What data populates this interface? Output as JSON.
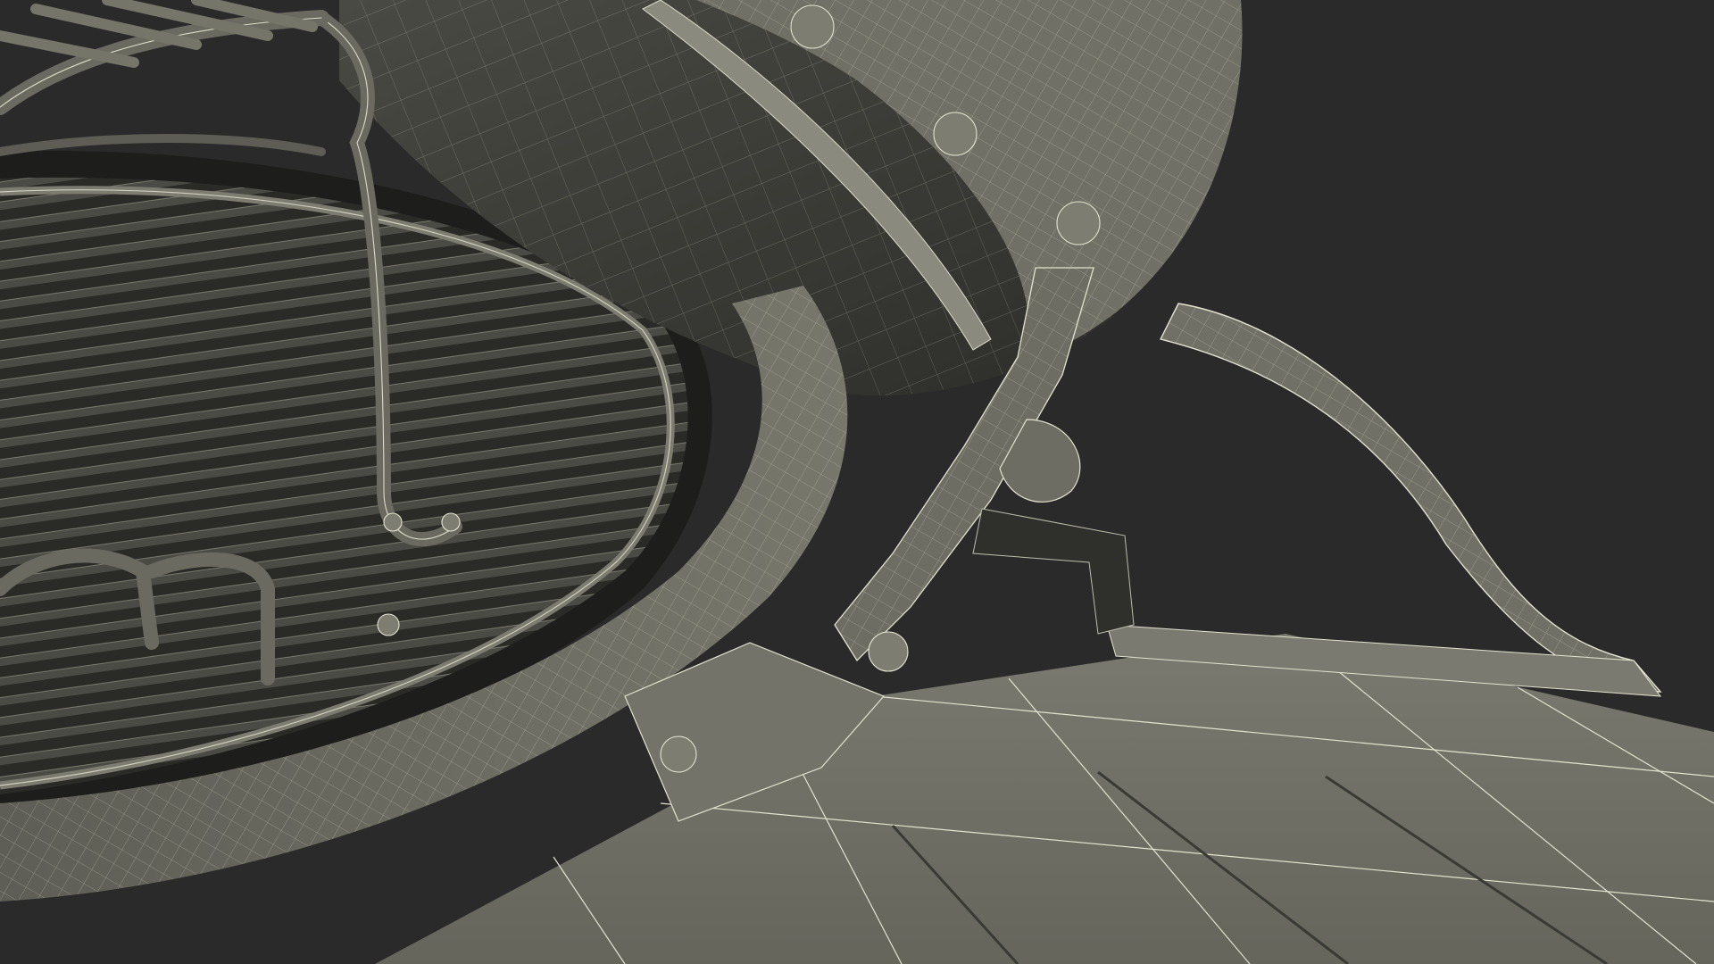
{
  "scene": {
    "subject": "grill-wireframe-render",
    "render_mode": "wireframe-over-shaded",
    "colors": {
      "background": "#2a2a2a",
      "surface": "#6d6d63",
      "surface_dark": "#3c3c38",
      "surface_shadow": "#1f1f1d",
      "wire": "#e6e6d4"
    }
  }
}
